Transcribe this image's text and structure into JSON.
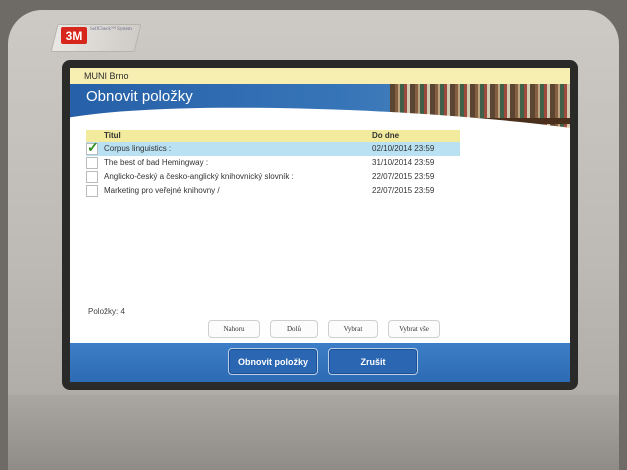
{
  "brand": {
    "logo_text": "3M",
    "logo_sub": "SelfCheck™ System"
  },
  "header": {
    "location": "MUNI Brno",
    "title": "Obnovit položky"
  },
  "table": {
    "col_title": "Titul",
    "col_due": "Do dne",
    "rows": [
      {
        "title": "Corpus linguistics :",
        "due": "02/10/2014 23:59",
        "selected": true
      },
      {
        "title": "The best of bad Hemingway :",
        "due": "31/10/2014 23:59",
        "selected": false
      },
      {
        "title": "Anglicko-český a česko-anglický knihovnický slovník :",
        "due": "22/07/2015 23:59",
        "selected": false
      },
      {
        "title": "Marketing pro veřejné knihovny /",
        "due": "22/07/2015 23:59",
        "selected": false
      }
    ]
  },
  "items_count_label": "Položky: 4",
  "nav": {
    "up": "Nahoru",
    "down": "Dolů",
    "select": "Vybrat",
    "select_all": "Vybrat vše"
  },
  "actions": {
    "renew": "Obnovit položky",
    "cancel": "Zrušit"
  },
  "colors": {
    "header_blue": "#2660a8",
    "accent_green": "#1d7858",
    "selected_row": "#b9e1f2",
    "header_row": "#f2eb9e"
  }
}
